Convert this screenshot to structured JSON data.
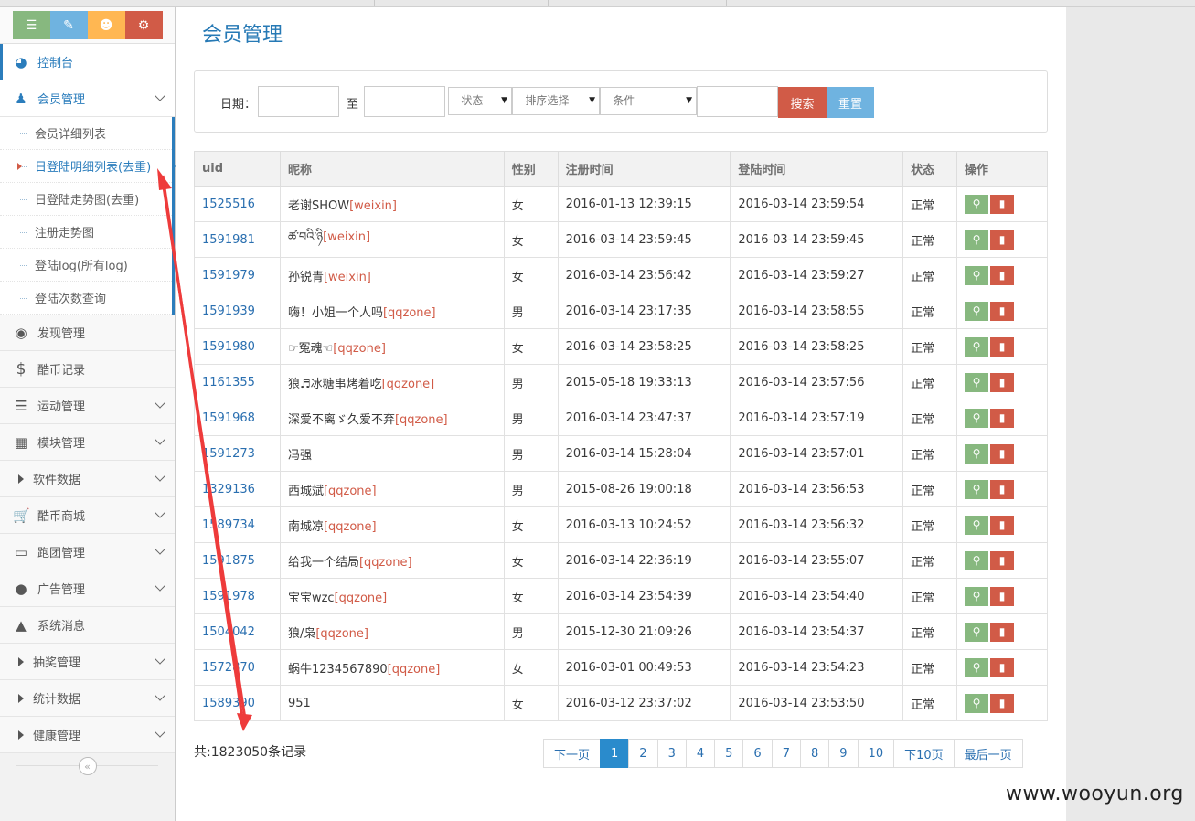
{
  "sidebar": {
    "shortcut_colors": [
      "#87b87f",
      "#6fb3e0",
      "#ffb752",
      "#d15b47"
    ],
    "shortcut_icons": [
      "signal-icon",
      "pencil-icon",
      "users-icon",
      "cogs-icon"
    ],
    "items": [
      {
        "label": "控制台",
        "icon": "dashboard-icon"
      },
      {
        "label": "会员管理",
        "icon": "user-icon"
      },
      {
        "label": "发现管理",
        "icon": "camera-icon"
      },
      {
        "label": "酷币记录",
        "icon": "dollar-icon"
      },
      {
        "label": "运动管理",
        "icon": "list-icon"
      },
      {
        "label": "模块管理",
        "icon": "windows-icon"
      },
      {
        "label": "软件数据",
        "icon": "caret-right-icon"
      },
      {
        "label": "酷币商城",
        "icon": "cart-icon"
      },
      {
        "label": "跑团管理",
        "icon": "laptop-icon"
      },
      {
        "label": "广告管理",
        "icon": "globe-icon"
      },
      {
        "label": "系统消息",
        "icon": "bell-icon"
      },
      {
        "label": "抽奖管理",
        "icon": "caret-right-icon"
      },
      {
        "label": "统计数据",
        "icon": "caret-right-icon"
      },
      {
        "label": "健康管理",
        "icon": "caret-right-icon"
      }
    ],
    "submenu": [
      "会员详细列表",
      "日登陆明细列表(去重)",
      "日登陆走势图(去重)",
      "注册走势图",
      "登陆log(所有log)",
      "登陆次数查询"
    ]
  },
  "main": {
    "title": "会员管理",
    "filter": {
      "date_label": "日期：",
      "to_label": "至",
      "status_select": "-状态-",
      "sort_select": "-排序选择-",
      "cond_select": "-条件-",
      "search_btn": "搜索",
      "reset_btn": "重置"
    },
    "table": {
      "headers": [
        "uid",
        "昵称",
        "性别",
        "注册时间",
        "登陆时间",
        "状态",
        "操作"
      ],
      "rows": [
        {
          "uid": "1525516",
          "nick": "老谢SHOW",
          "src": "[weixin]",
          "sex": "女",
          "reg": "2016-01-13 12:39:15",
          "login": "2016-03-14 23:59:54",
          "status": "正常"
        },
        {
          "uid": "1591981",
          "nick": "ཚ་བའི་ཉི",
          "src": "[weixin]",
          "sex": "女",
          "reg": "2016-03-14 23:59:45",
          "login": "2016-03-14 23:59:45",
          "status": "正常"
        },
        {
          "uid": "1591979",
          "nick": "孙锐青",
          "src": "[weixin]",
          "sex": "女",
          "reg": "2016-03-14 23:56:42",
          "login": "2016-03-14 23:59:27",
          "status": "正常"
        },
        {
          "uid": "1591939",
          "nick": "嗨！小姐一个人吗",
          "src": "[qqzone]",
          "sex": "男",
          "reg": "2016-03-14 23:17:35",
          "login": "2016-03-14 23:58:55",
          "status": "正常"
        },
        {
          "uid": "1591980",
          "nick": "☞冤魂☜",
          "src": "[qqzone]",
          "sex": "女",
          "reg": "2016-03-14 23:58:25",
          "login": "2016-03-14 23:58:25",
          "status": "正常"
        },
        {
          "uid": "1161355",
          "nick": "狼♬冰糖串烤着吃",
          "src": "[qqzone]",
          "sex": "男",
          "reg": "2015-05-18 19:33:13",
          "login": "2016-03-14 23:57:56",
          "status": "正常"
        },
        {
          "uid": "1591968",
          "nick": "深爱不离ゞ久爱不弃",
          "src": "[qqzone]",
          "sex": "男",
          "reg": "2016-03-14 23:47:37",
          "login": "2016-03-14 23:57:19",
          "status": "正常"
        },
        {
          "uid": "1591273",
          "nick": "冯强",
          "src": "",
          "sex": "男",
          "reg": "2016-03-14 15:28:04",
          "login": "2016-03-14 23:57:01",
          "status": "正常"
        },
        {
          "uid": "1329136",
          "nick": "西城斌",
          "src": "[qqzone]",
          "sex": "男",
          "reg": "2015-08-26 19:00:18",
          "login": "2016-03-14 23:56:53",
          "status": "正常"
        },
        {
          "uid": "1589734",
          "nick": "南城凉",
          "src": "[qqzone]",
          "sex": "女",
          "reg": "2016-03-13 10:24:52",
          "login": "2016-03-14 23:56:32",
          "status": "正常"
        },
        {
          "uid": "1591875",
          "nick": "给我一个结局",
          "src": "[qqzone]",
          "sex": "女",
          "reg": "2016-03-14 22:36:19",
          "login": "2016-03-14 23:55:07",
          "status": "正常"
        },
        {
          "uid": "1591978",
          "nick": "宝宝wzc",
          "src": "[qqzone]",
          "sex": "女",
          "reg": "2016-03-14 23:54:39",
          "login": "2016-03-14 23:54:40",
          "status": "正常"
        },
        {
          "uid": "1504042",
          "nick": "狼/枭",
          "src": "[qqzone]",
          "sex": "男",
          "reg": "2015-12-30 21:09:26",
          "login": "2016-03-14 23:54:37",
          "status": "正常"
        },
        {
          "uid": "1572870",
          "nick": "蜗牛1234567890",
          "src": "[qqzone]",
          "sex": "女",
          "reg": "2016-03-01 00:49:53",
          "login": "2016-03-14 23:54:23",
          "status": "正常"
        },
        {
          "uid": "1589390",
          "nick": "951",
          "src": "",
          "sex": "女",
          "reg": "2016-03-12 23:37:02",
          "login": "2016-03-14 23:53:50",
          "status": "正常"
        }
      ]
    },
    "total": "共:1823050条记录",
    "pager": [
      "下一页",
      "1",
      "2",
      "3",
      "4",
      "5",
      "6",
      "7",
      "8",
      "9",
      "10",
      "下10页",
      "最后一页"
    ],
    "pager_active": "1"
  },
  "watermark": "www.wooyun.org"
}
